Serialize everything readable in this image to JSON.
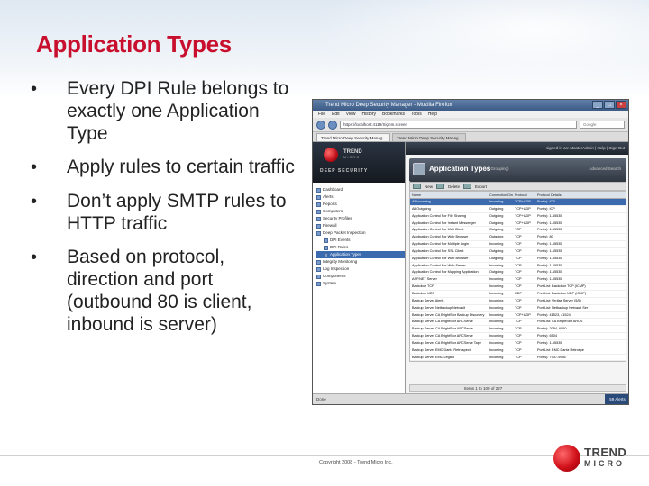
{
  "slide": {
    "title": "Application Types",
    "bullet_glyph": "•",
    "bullets": [
      "Every DPI Rule belongs to exactly one Application Type",
      "Apply rules to certain traffic",
      "Don’t apply SMTP rules to HTTP traffic",
      "Based on protocol, direction and port (outbound 80 is client, inbound is server)"
    ],
    "copyright": "Copyright 2008 - Trend Micro Inc.",
    "logo_line1": "TREND",
    "logo_line2": "MICRO"
  },
  "browser": {
    "title": "Trend Micro Deep Security Manager - Mozilla Firefox",
    "menus": [
      "File",
      "Edit",
      "View",
      "History",
      "Bookmarks",
      "Tools",
      "Help"
    ],
    "url": "https://localhost:4119/SignIn.screen",
    "search_placeholder": "Google",
    "tabs": [
      "Trend Micro Deep Security Manag...",
      "Trend Micro Deep Security Manag..."
    ],
    "status_left": "Done",
    "alerts": "59 Alerts"
  },
  "app": {
    "brand_line1": "TREND",
    "brand_line2": "MICRO",
    "brand_product": "DEEP SECURITY",
    "top_strip": "signed in as: MasterAdmin | Help | Sign Out",
    "tree": [
      "Dashboard",
      "Alerts",
      "Reports",
      "Computers",
      "Security Profiles",
      "Firewall",
      "Deep Packet Inspection",
      "DPI Events",
      "DPI Rules",
      "Application Types",
      "Integrity Monitoring",
      "Log Inspection",
      "Components",
      "System"
    ],
    "panel_title": "Application Types",
    "panel_subtitle": "(No Grouping)",
    "panel_search": "Advanced Search",
    "toolbar": {
      "new": "New",
      "delete": "Delete",
      "export": "Export"
    },
    "columns": [
      "Name",
      "Connection Direction",
      "Protocol",
      "Protocol Details"
    ],
    "rows": [
      [
        "All Incoming",
        "Incoming",
        "TCP+UDP",
        "Port(s): ICP"
      ],
      [
        "All Outgoing",
        "Outgoing",
        "TCP+UDP",
        "Port(s): ICP"
      ],
      [
        "Application Control For File Sharing",
        "Outgoing",
        "TCP+UDP",
        "Port(s): 1-65535"
      ],
      [
        "Application Control For Instant Messenger",
        "Outgoing",
        "TCP+UDP",
        "Port(s): 1-65535"
      ],
      [
        "Application Control For Mail Client",
        "Outgoing",
        "TCP",
        "Port(s): 1-65535"
      ],
      [
        "Application Control For Web Browser",
        "Outgoing",
        "TCP",
        "Port(s): 80"
      ],
      [
        "Application Control For Multiple Login",
        "Incoming",
        "TCP",
        "Port(s): 1-65535"
      ],
      [
        "Application Control For SSL Client",
        "Outgoing",
        "TCP",
        "Port(s): 1-65535"
      ],
      [
        "Application Control For Web Browser",
        "Outgoing",
        "TCP",
        "Port(s): 1-65535"
      ],
      [
        "Application Control For Web Server",
        "Incoming",
        "TCP",
        "Port(s): 1-65535"
      ],
      [
        "Application Control For Mapping Application",
        "Outgoing",
        "TCP",
        "Port(s): 1-65535"
      ],
      [
        "ASP.NET Server",
        "Incoming",
        "TCP",
        "Port(s): 1-65535"
      ],
      [
        "Backdoor TCP",
        "Incoming",
        "TCP",
        "Port List: Backdoor TCP (ICMP)"
      ],
      [
        "Backdoor UDP",
        "Incoming",
        "UDP",
        "Port List: Backdoor UDP (ICMP)"
      ],
      [
        "Backup Server Alerts",
        "Incoming",
        "TCP",
        "Port List: Veritas Server (5/5)"
      ],
      [
        "Backup Server Netbackup Netvault",
        "Incoming",
        "TCP",
        "Port List: Netbackup Netvault Ser"
      ],
      [
        "Backup Server CA BrightStor Backup Discovery",
        "Incoming",
        "TCP+UDP",
        "Port(s): 41523, 41524"
      ],
      [
        "Backup Server CA BrightStor ARCServe",
        "Incoming",
        "TCP",
        "Port List: CA BrightStor ARCS"
      ],
      [
        "Backup Server CA BrightStor ARCServe",
        "Incoming",
        "TCP",
        "Port(s): 2084, 6050"
      ],
      [
        "Backup Server CA BrightStor ARCServe",
        "Incoming",
        "TCP",
        "Port(s): 6504"
      ],
      [
        "Backup Server CA BrightStor ARCServe Tape",
        "Incoming",
        "TCP",
        "Port(s): 1-65535"
      ],
      [
        "Backup Server EMC Dantz Retrospect",
        "Incoming",
        "TCP",
        "Port List: EMC Dantz Retrospe"
      ],
      [
        "Backup Server EMC Legato",
        "Incoming",
        "TCP",
        "Port(s): 7937-9936"
      ]
    ],
    "statusbar": "Items 1 to 100 of 227"
  }
}
